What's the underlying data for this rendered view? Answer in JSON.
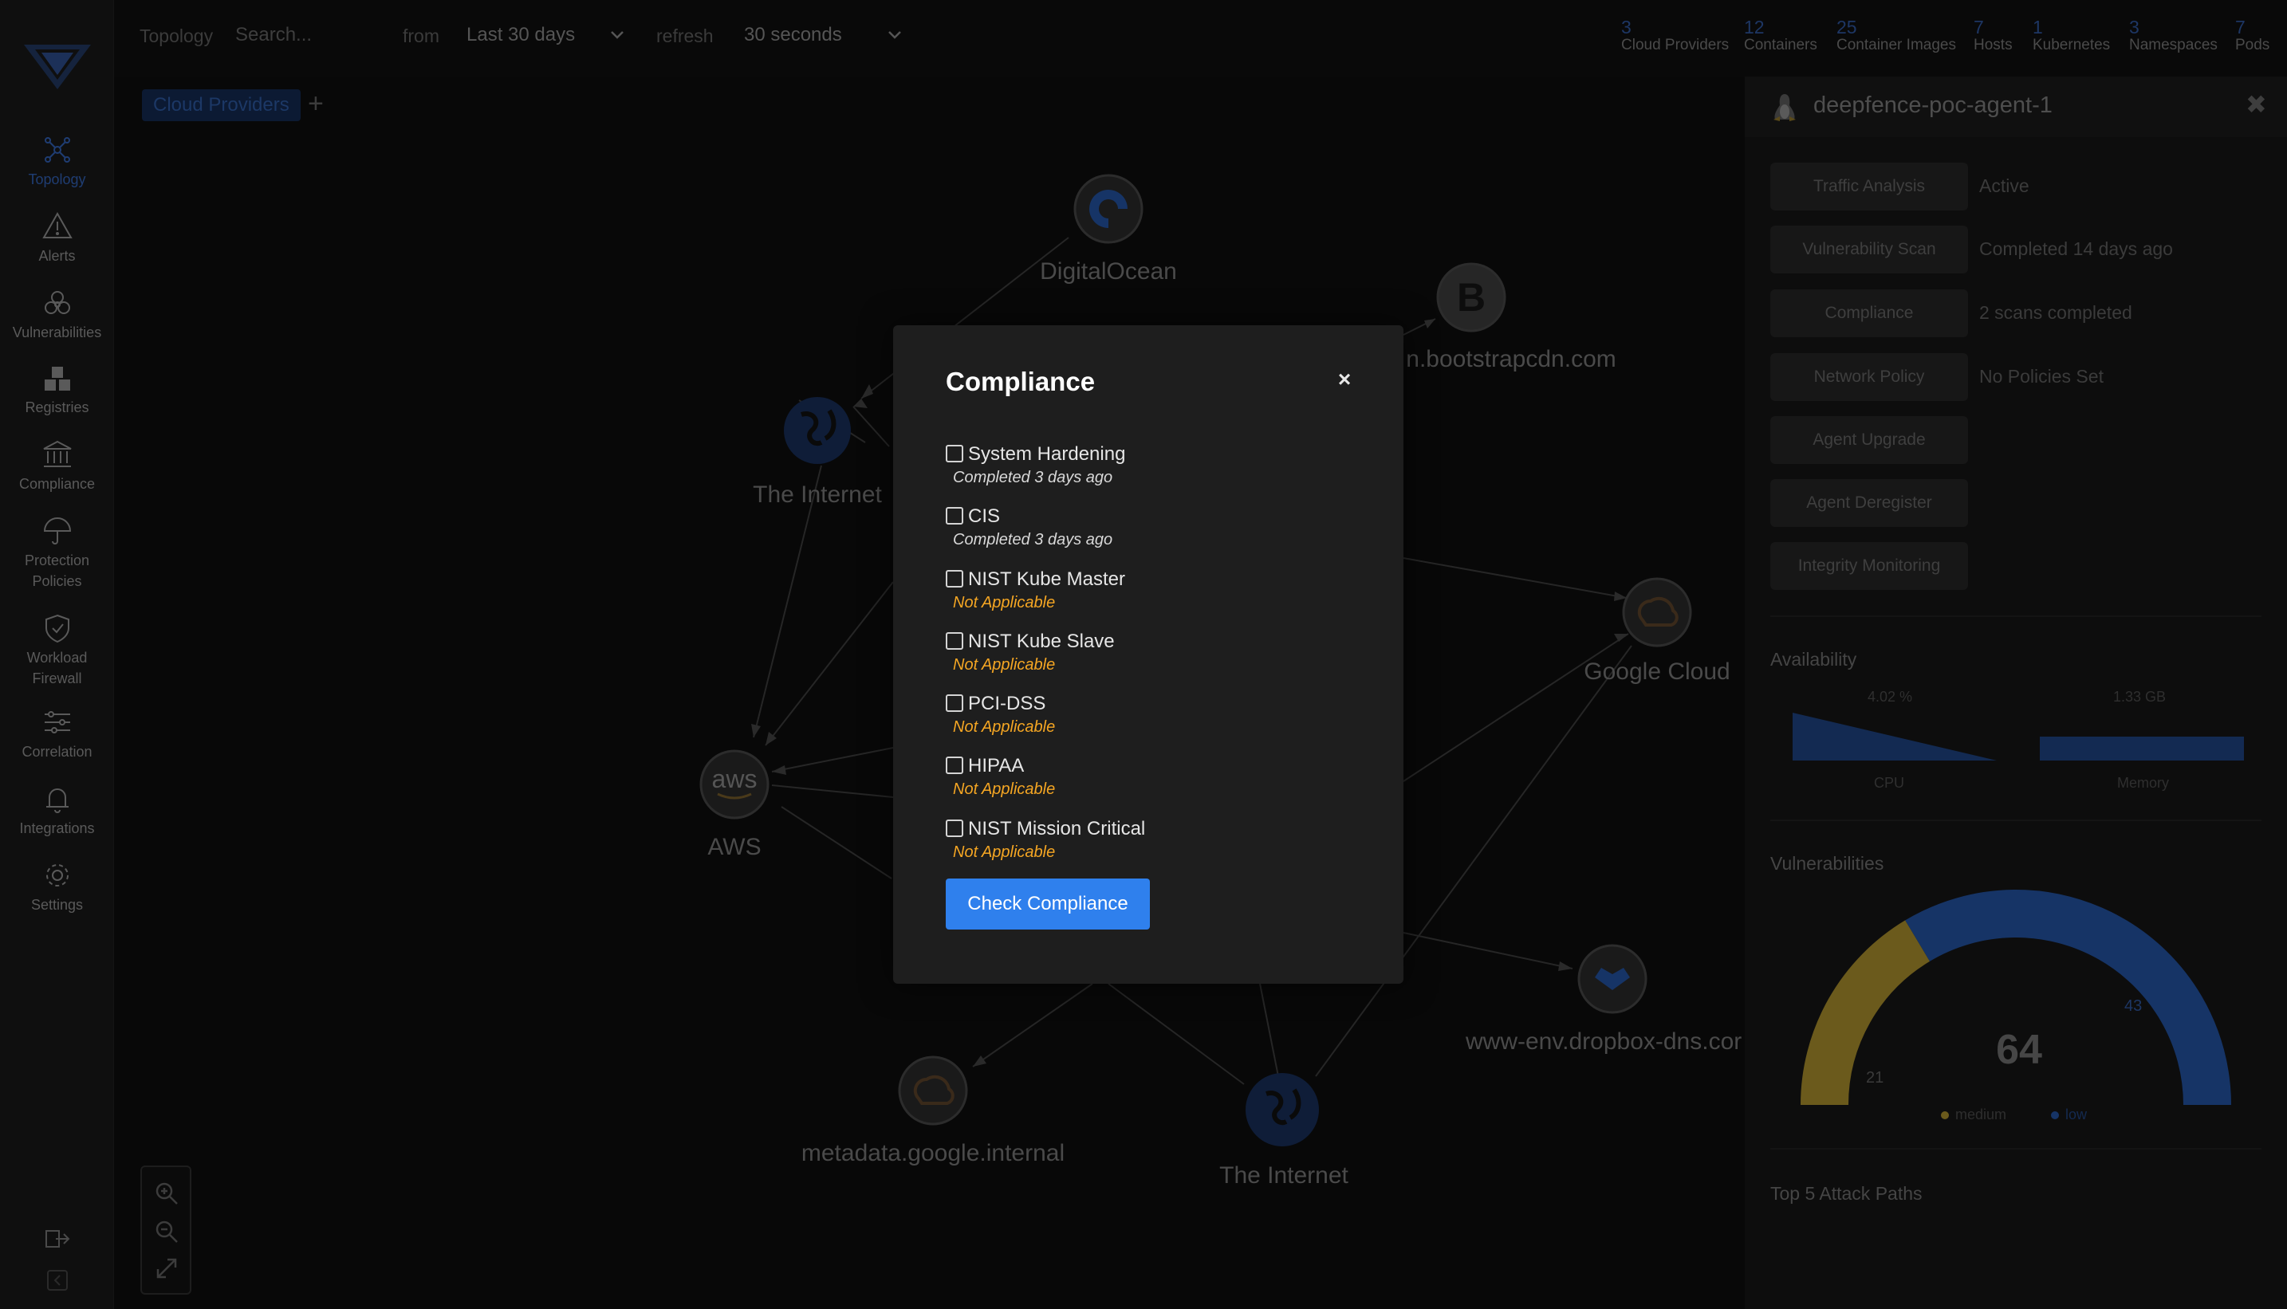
{
  "sidebar": {
    "items": [
      {
        "label": "Topology",
        "icon": "topology-icon",
        "active": true
      },
      {
        "label": "Alerts",
        "icon": "alert-icon"
      },
      {
        "label": "Vulnerabilities",
        "icon": "biohazard-icon"
      },
      {
        "label": "Registries",
        "icon": "registry-icon"
      },
      {
        "label": "Compliance",
        "icon": "compliance-icon"
      },
      {
        "label": "Protection",
        "label2": "Policies",
        "icon": "umbrella-icon"
      },
      {
        "label": "Workload",
        "label2": "Firewall",
        "icon": "shield-icon"
      },
      {
        "label": "Correlation",
        "icon": "sliders-icon"
      },
      {
        "label": "Integrations",
        "icon": "bell-icon"
      },
      {
        "label": "Settings",
        "icon": "gear-icon"
      }
    ]
  },
  "topbar": {
    "section": "Topology",
    "search_placeholder": "Search...",
    "from_label": "from",
    "from_value": "Last 30 days",
    "refresh_label": "refresh",
    "refresh_value": "30 seconds",
    "stats": [
      {
        "num": "3",
        "label": "Cloud Providers"
      },
      {
        "num": "12",
        "label": "Containers"
      },
      {
        "num": "25",
        "label": "Container Images"
      },
      {
        "num": "7",
        "label": "Hosts"
      },
      {
        "num": "1",
        "label": "Kubernetes"
      },
      {
        "num": "3",
        "label": "Namespaces"
      },
      {
        "num": "7",
        "label": "Pods"
      }
    ]
  },
  "graph": {
    "tab": "Cloud Providers",
    "add": "+",
    "nodes": {
      "digitalocean": "DigitalOcean",
      "bootstrap": "maxcdn.bootstrapcdn.com",
      "bootstrap_visible": "n.bootstrapcdn.com",
      "internet1": "The Internet",
      "google": "Google Cloud",
      "aws": "AWS",
      "aws_logo": "aws",
      "dropbox": "www-env.dropbox-dns.com",
      "dropbox_visible": "www-env.dropbox-dns.cor",
      "metadata": "metadata.google.internal",
      "internet2": "The Internet"
    }
  },
  "panel": {
    "title": "deepfence-poc-agent-1",
    "actions": [
      {
        "label": "Traffic Analysis",
        "status": "Active"
      },
      {
        "label": "Vulnerability Scan",
        "status": "Completed 14 days ago"
      },
      {
        "label": "Compliance",
        "status": "2 scans completed"
      },
      {
        "label": "Network Policy",
        "status": "No Policies Set"
      },
      {
        "label": "Agent Upgrade",
        "status": ""
      },
      {
        "label": "Agent Deregister",
        "status": ""
      },
      {
        "label": "Integrity Monitoring",
        "status": ""
      }
    ],
    "availability": {
      "title": "Availability",
      "cpu_value": "4.02 %",
      "cpu_label": "CPU",
      "mem_value": "1.33 GB",
      "mem_label": "Memory"
    },
    "vulnerabilities": {
      "title": "Vulnerabilities",
      "total": "64",
      "medium": 21,
      "low": 43,
      "medium_label": "medium",
      "low_label": "low",
      "medium_color": "#6b5a1c",
      "low_color": "#163466"
    },
    "attack_paths_title": "Top 5 Attack Paths"
  },
  "modal": {
    "title": "Compliance",
    "close": "×",
    "options": [
      {
        "label": "System Hardening",
        "status": "Completed 3 days ago",
        "kind": "done"
      },
      {
        "label": "CIS",
        "status": "Completed 3 days ago",
        "kind": "done"
      },
      {
        "label": "NIST Kube Master",
        "status": "Not Applicable",
        "kind": "na"
      },
      {
        "label": "NIST Kube Slave",
        "status": "Not Applicable",
        "kind": "na"
      },
      {
        "label": "PCI-DSS",
        "status": "Not Applicable",
        "kind": "na"
      },
      {
        "label": "HIPAA",
        "status": "Not Applicable",
        "kind": "na"
      },
      {
        "label": "NIST Mission Critical",
        "status": "Not Applicable",
        "kind": "na"
      }
    ],
    "button": "Check Compliance",
    "button_color": "#2f80ed"
  }
}
